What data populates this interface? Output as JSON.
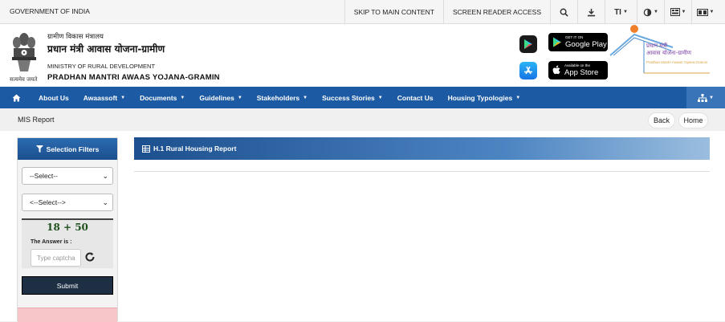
{
  "topbar": {
    "gov_label": "GOVERNMENT OF INDIA",
    "skip_label": "SKIP TO MAIN CONTENT",
    "screen_reader_label": "SCREEN READER ACCESS",
    "text_size_label": "TI"
  },
  "header": {
    "emblem_caption": "सत्यमेव जयते",
    "ministry_hi": "ग्रामीण विकास मंत्रालय",
    "scheme_hi": "प्रधान मंत्री आवास योजना-ग्रामीण",
    "ministry_en": "MINISTRY OF RURAL DEVELOPMENT",
    "scheme_en": "PRADHAN MANTRI AWAAS YOJANA-GRAMIN",
    "google_play_small": "GET IT ON",
    "google_play_big": "Google Play",
    "app_store_small": "Available on the",
    "app_store_big": "App Store",
    "logo_line1": "प्रधान मंत्री",
    "logo_line2": "आवास योजना-ग्रामीण",
    "logo_line3": "Pradhan Mantri Awaas Yojana-Gramin"
  },
  "nav": {
    "items": [
      {
        "label": "About Us",
        "caret": false
      },
      {
        "label": "Awaassoft",
        "caret": true
      },
      {
        "label": "Documents",
        "caret": true
      },
      {
        "label": "Guidelines",
        "caret": true
      },
      {
        "label": "Stakeholders",
        "caret": true
      },
      {
        "label": "Success Stories",
        "caret": true
      },
      {
        "label": "Contact Us",
        "caret": false
      },
      {
        "label": "Housing Typologies",
        "caret": true
      }
    ]
  },
  "breadcrumb": {
    "title": "MIS Report",
    "back_label": "Back",
    "home_label": "Home"
  },
  "filters": {
    "title": "Selection Filters",
    "select1_value": "--Select--",
    "select2_value": "<--Select-->",
    "captcha_expression": "18 + 50",
    "answer_label": "The Answer is :",
    "answer_placeholder": "Type captcha",
    "submit_label": "Submit"
  },
  "report": {
    "title": "H.1 Rural Housing Report"
  },
  "colors": {
    "nav_blue": "#1c5ba3",
    "submit_dark": "#1e2f44",
    "alert_pink": "#f7c6c9"
  }
}
